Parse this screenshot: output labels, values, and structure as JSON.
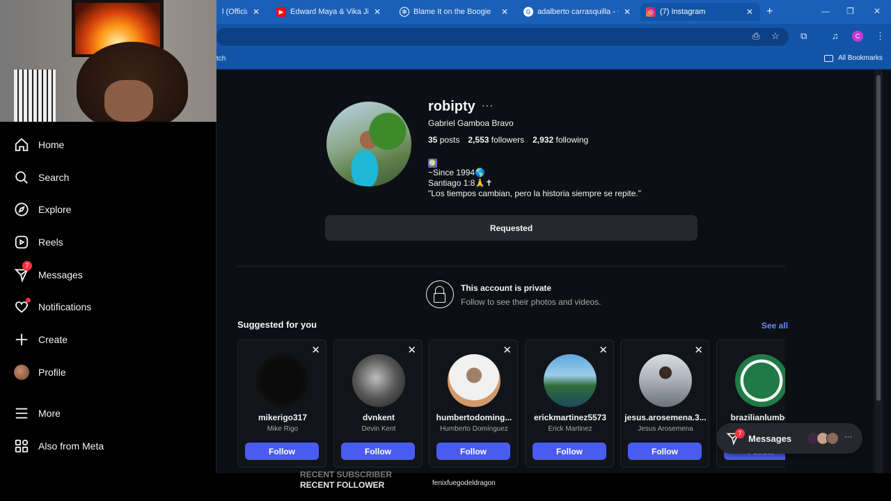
{
  "browser": {
    "tabs": [
      {
        "label": "l (Official",
        "favicon": "youtube-icon",
        "color": "#ff0000"
      },
      {
        "label": "Edward Maya & Vika Jigulin",
        "favicon": "youtube-icon",
        "color": "#ff0000"
      },
      {
        "label": "Blame It on the Boogie",
        "favicon": "chatgpt-icon",
        "color": "#ffffff"
      },
      {
        "label": "adalberto carrasquilla - Go",
        "favicon": "google-icon",
        "color": "#4285f4"
      },
      {
        "label": "(7) Instagram",
        "favicon": "instagram-icon",
        "color": "#e1306c"
      }
    ],
    "profile_initial": "C",
    "bookmarks_left": "tch",
    "bookmarks_all": "All Bookmarks"
  },
  "sidebar": {
    "items": [
      {
        "label": "Home",
        "icon": "home-icon"
      },
      {
        "label": "Search",
        "icon": "search-icon"
      },
      {
        "label": "Explore",
        "icon": "compass-icon"
      },
      {
        "label": "Reels",
        "icon": "reels-icon"
      },
      {
        "label": "Messages",
        "icon": "messenger-icon",
        "badge": "7"
      },
      {
        "label": "Notifications",
        "icon": "heart-icon"
      },
      {
        "label": "Create",
        "icon": "plus-icon"
      },
      {
        "label": "Profile",
        "icon": "profile-avatar"
      },
      {
        "label": "More",
        "icon": "menu-icon"
      },
      {
        "label": "Also from Meta",
        "icon": "meta-grid-icon"
      }
    ]
  },
  "profile": {
    "username": "robipty",
    "more": "···",
    "full_name": "Gabriel Gamboa Bravo",
    "posts_count": "35",
    "posts_label": "posts",
    "followers_count": "2,553",
    "followers_label": "followers",
    "following_count": "2,932",
    "following_label": "following",
    "bio_zodiac": "♍",
    "bio_line1": "~Since 1994🌎",
    "bio_line2": "Santiago 1:8🙏✝",
    "bio_line3": "\"Los tiempos cambian, pero la historia siempre se repite.\"",
    "requested_label": "Requested",
    "private_title": "This account is private",
    "private_sub": "Follow to see their photos and videos."
  },
  "suggested": {
    "title": "Suggested for you",
    "see_all": "See all",
    "follow_label": "Follow",
    "cards": [
      {
        "handle": "mikerigo317",
        "name": "Mike Rigo"
      },
      {
        "handle": "dvnkent",
        "name": "Devin Kent"
      },
      {
        "handle": "humbertodoming...",
        "name": "Humberto Domínguez"
      },
      {
        "handle": "erickmartinez5573",
        "name": "Erick Martinez"
      },
      {
        "handle": "jesus.arosemena.3...",
        "name": "Jesus Arosemena"
      },
      {
        "handle": "brazilianlumber",
        "name": ""
      }
    ]
  },
  "messages_float": {
    "label": "Messages",
    "badge": "7",
    "more": "···"
  },
  "stream_overlay": {
    "line1": "RECENT SUBSCRIBER",
    "line2": "RECENT FOLLOWER",
    "follower_name": "fenixfuegodeldragon"
  }
}
